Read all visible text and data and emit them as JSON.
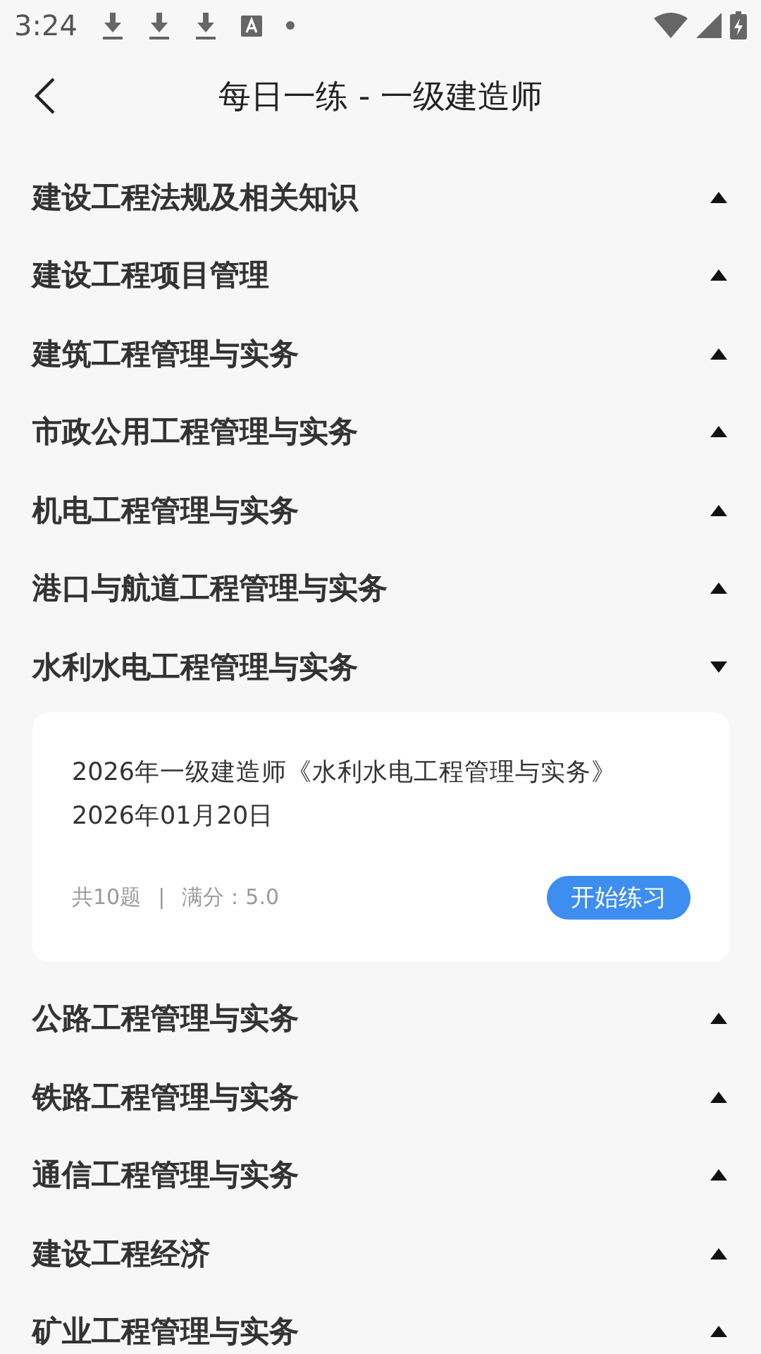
{
  "status_bar": {
    "time": "3:24"
  },
  "nav": {
    "title": "每日一练 - 一级建造师"
  },
  "subjects": [
    {
      "title": "建设工程法规及相关知识",
      "expanded": false
    },
    {
      "title": "建设工程项目管理",
      "expanded": false
    },
    {
      "title": "建筑工程管理与实务",
      "expanded": false
    },
    {
      "title": "市政公用工程管理与实务",
      "expanded": false
    },
    {
      "title": "机电工程管理与实务",
      "expanded": false
    },
    {
      "title": "港口与航道工程管理与实务",
      "expanded": false
    },
    {
      "title": "水利水电工程管理与实务",
      "expanded": true,
      "card": {
        "name": "2026年一级建造师《水利水电工程管理与实务》",
        "date": "2026年01月20日",
        "count": "共10题",
        "separator": "|",
        "score": "满分：5.0",
        "button": "开始练习"
      }
    },
    {
      "title": "公路工程管理与实务",
      "expanded": false
    },
    {
      "title": "铁路工程管理与实务",
      "expanded": false
    },
    {
      "title": "通信工程管理与实务",
      "expanded": false
    },
    {
      "title": "建设工程经济",
      "expanded": false
    },
    {
      "title": "矿业工程管理与实务",
      "expanded": false
    }
  ]
}
